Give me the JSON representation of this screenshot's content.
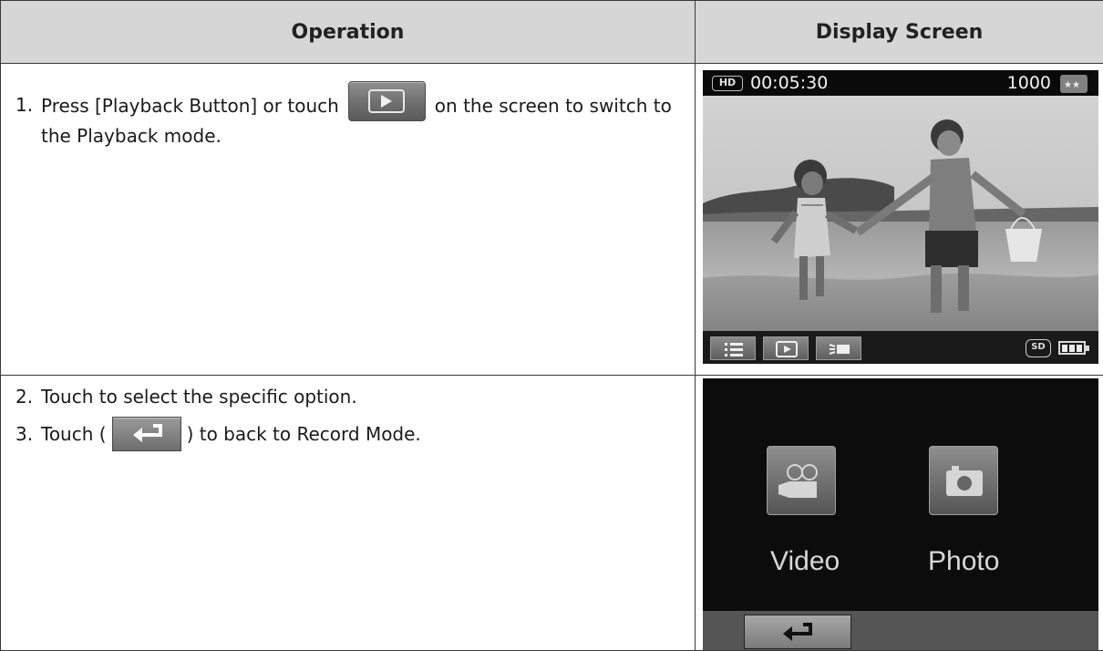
{
  "table": {
    "headers": [
      "Operation",
      "Display Screen"
    ]
  },
  "steps": [
    {
      "num": "1.",
      "before": "Press [Playback Button] or touch",
      "after": "on the screen to switch to the Playback mode."
    },
    {
      "num": "2.",
      "text": "Touch to select the specific option."
    },
    {
      "num": "3.",
      "before": "Touch (",
      "after": ") to back to Record Mode."
    }
  ],
  "screen1": {
    "hd_badge": "HD",
    "time": "00:05:30",
    "count": "1000",
    "sd_badge": "SD",
    "icons": [
      "hd-icon",
      "resolution-icon",
      "menu-icon",
      "play-icon",
      "light-icon",
      "sd-card-icon",
      "battery-icon"
    ]
  },
  "screen2": {
    "modes": [
      "Video",
      "Photo"
    ],
    "icons": [
      "video-camera-icon",
      "photo-camera-icon",
      "back-arrow-icon"
    ]
  }
}
